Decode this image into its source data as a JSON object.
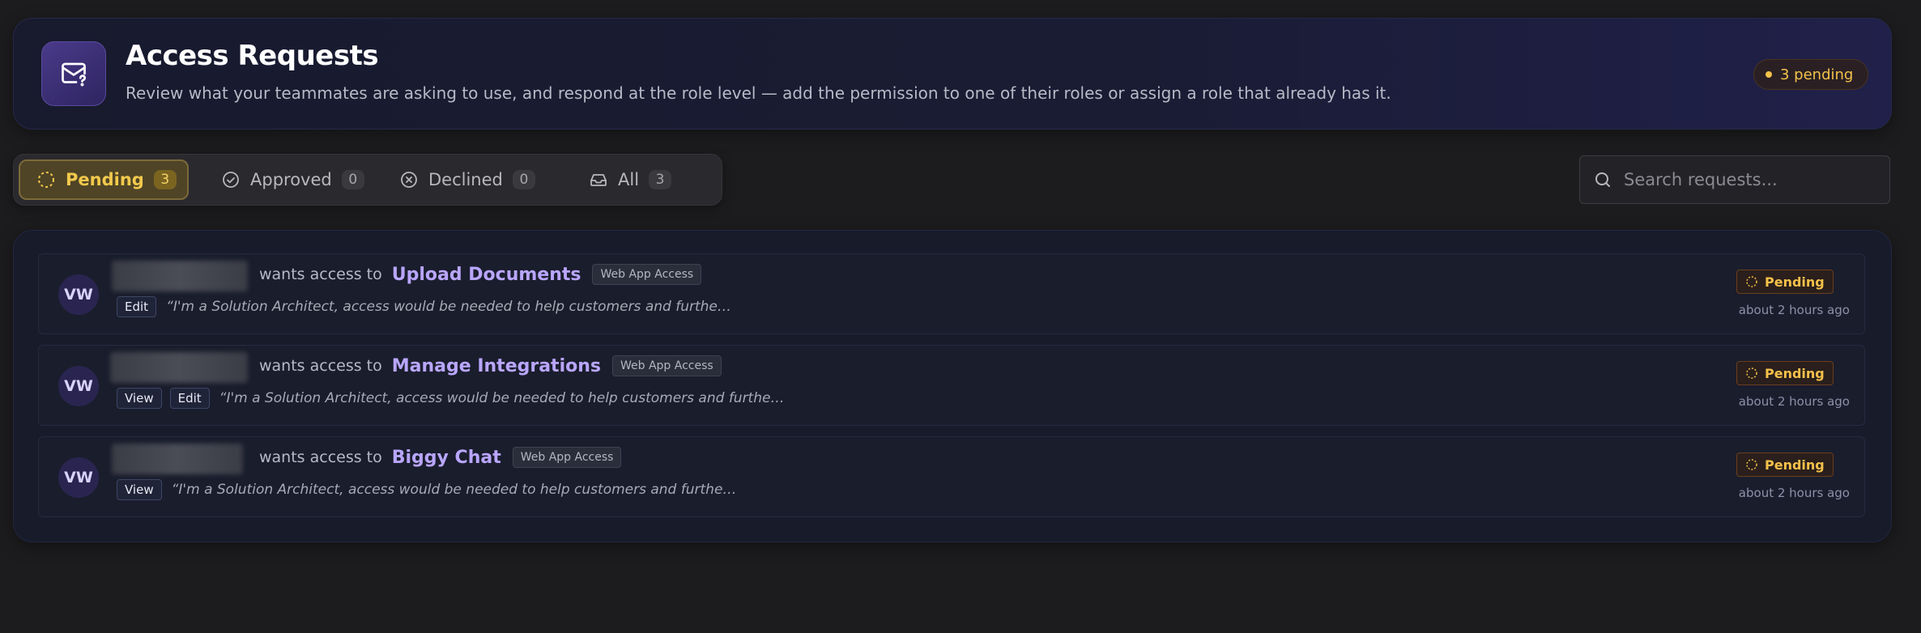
{
  "header": {
    "title": "Access Requests",
    "subtitle": "Review what your teammates are asking to use, and respond at the role level — add the permission to one of their roles or assign a role that already has it.",
    "pending_badge": "3 pending",
    "icon": "mail-question-icon"
  },
  "tabs": [
    {
      "label": "Pending",
      "count": "3",
      "icon": "dashed-circle-icon",
      "active": true
    },
    {
      "label": "Approved",
      "count": "0",
      "icon": "check-circle-icon",
      "active": false
    },
    {
      "label": "Declined",
      "count": "0",
      "icon": "x-circle-icon",
      "active": false
    },
    {
      "label": "All",
      "count": "3",
      "icon": "inbox-icon",
      "active": false
    }
  ],
  "search": {
    "placeholder": "Search requests..."
  },
  "requests": [
    {
      "initials": "VW",
      "wants_text": "wants access to",
      "permission": "Upload Documents",
      "app": "Web App Access",
      "scopes": [
        "Edit"
      ],
      "reason": "“I'm a Solution Architect, access would be needed to help customers and furthe…",
      "status": "Pending",
      "time": "about 2 hours ago"
    },
    {
      "initials": "VW",
      "wants_text": "wants access to",
      "permission": "Manage Integrations",
      "app": "Web App Access",
      "scopes": [
        "View",
        "Edit"
      ],
      "reason": "“I'm a Solution Architect, access would be needed to help customers and furthe…",
      "status": "Pending",
      "time": "about 2 hours ago"
    },
    {
      "initials": "VW",
      "wants_text": "wants access to",
      "permission": "Biggy Chat",
      "app": "Web App Access",
      "scopes": [
        "View"
      ],
      "reason": "“I'm a Solution Architect, access would be needed to help customers and furthe…",
      "status": "Pending",
      "time": "about 2 hours ago"
    }
  ],
  "colors": {
    "accent": "#b9a6ff",
    "pending": "#f2c24a",
    "background": "#1c1c1e"
  }
}
